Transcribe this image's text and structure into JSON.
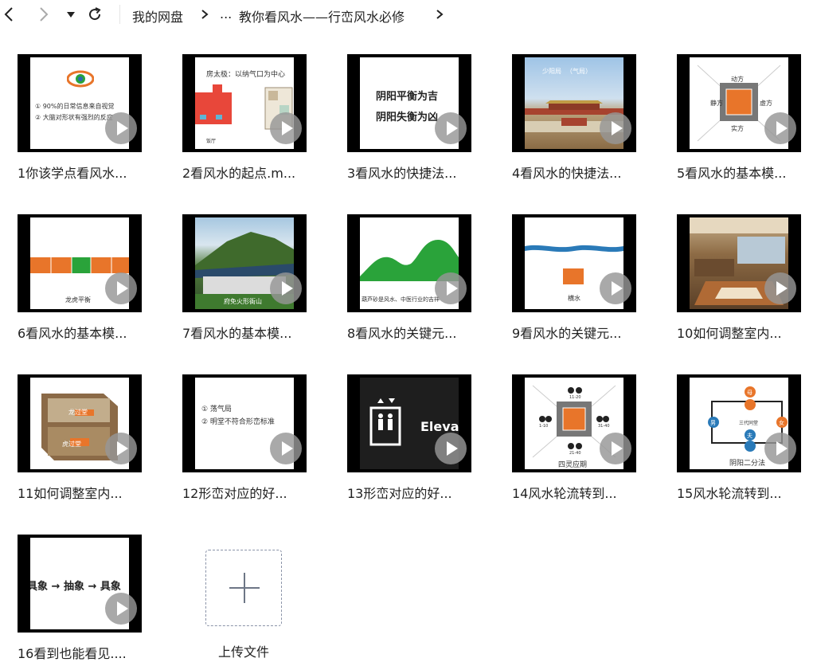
{
  "nav": {
    "breadcrumb_root": "我的网盘",
    "breadcrumb_ellipsis": "...",
    "breadcrumb_current": "教你看风水——行峦风水必修"
  },
  "files": [
    {
      "name": "1你该学点看风水...",
      "slide_lines": [
        "① 90%的日常信息来自视觉",
        "② 大脑对形状有强烈的反应"
      ]
    },
    {
      "name": "2看风水的起点.m...",
      "slide_lines": [
        "房太极：以纳气口为中心",
        "饭厅"
      ]
    },
    {
      "name": "3看风水的快捷法...",
      "slide_lines": [
        "阴阳平衡为吉",
        "阴阳失衡为凶"
      ]
    },
    {
      "name": "4看风水的快捷法...",
      "slide_lines": [
        "少阳局",
        "（气局）"
      ]
    },
    {
      "name": "5看风水的基本模...",
      "slide_lines": [
        "动方",
        "静方",
        "实方",
        "虚方"
      ]
    },
    {
      "name": "6看风水的基本模...",
      "slide_lines": [
        "龙虎平衡"
      ]
    },
    {
      "name": "7看风水的基本模...",
      "slide_lines": [
        "府免火形衙山"
      ]
    },
    {
      "name": "8看风水的关键元...",
      "slide_lines": [
        "葫芦砂是风水、中医行业的吉祥"
      ]
    },
    {
      "name": "9看风水的关键元...",
      "slide_lines": [
        "横水"
      ]
    },
    {
      "name": "10如何调整室内...",
      "slide_lines": []
    },
    {
      "name": "11如何调整室内...",
      "slide_lines": [
        "龙过堂",
        "虎过堂"
      ]
    },
    {
      "name": "12形峦对应的好...",
      "slide_lines": [
        "① 荡气局",
        "② 明堂不符合形峦标准"
      ]
    },
    {
      "name": "13形峦对应的好...",
      "slide_lines": [
        "Elevat"
      ]
    },
    {
      "name": "14风水轮流转到...",
      "slide_lines": [
        "四灵应期",
        "11-20",
        "1-10",
        "31-40",
        "21-40"
      ]
    },
    {
      "name": "15风水轮流转到...",
      "slide_lines": [
        "阴阳二分法",
        "三代同堂",
        "母",
        "男",
        "女",
        "夫"
      ]
    },
    {
      "name": "16看到也能看见....",
      "slide_lines": [
        "具象 → 抽象 → 具象"
      ]
    }
  ],
  "upload": {
    "label": "上传文件"
  },
  "colors": {
    "orange": "#e8752a",
    "green": "#2aa33a",
    "play_overlay": "#969696",
    "tile_bg": "#000000"
  }
}
